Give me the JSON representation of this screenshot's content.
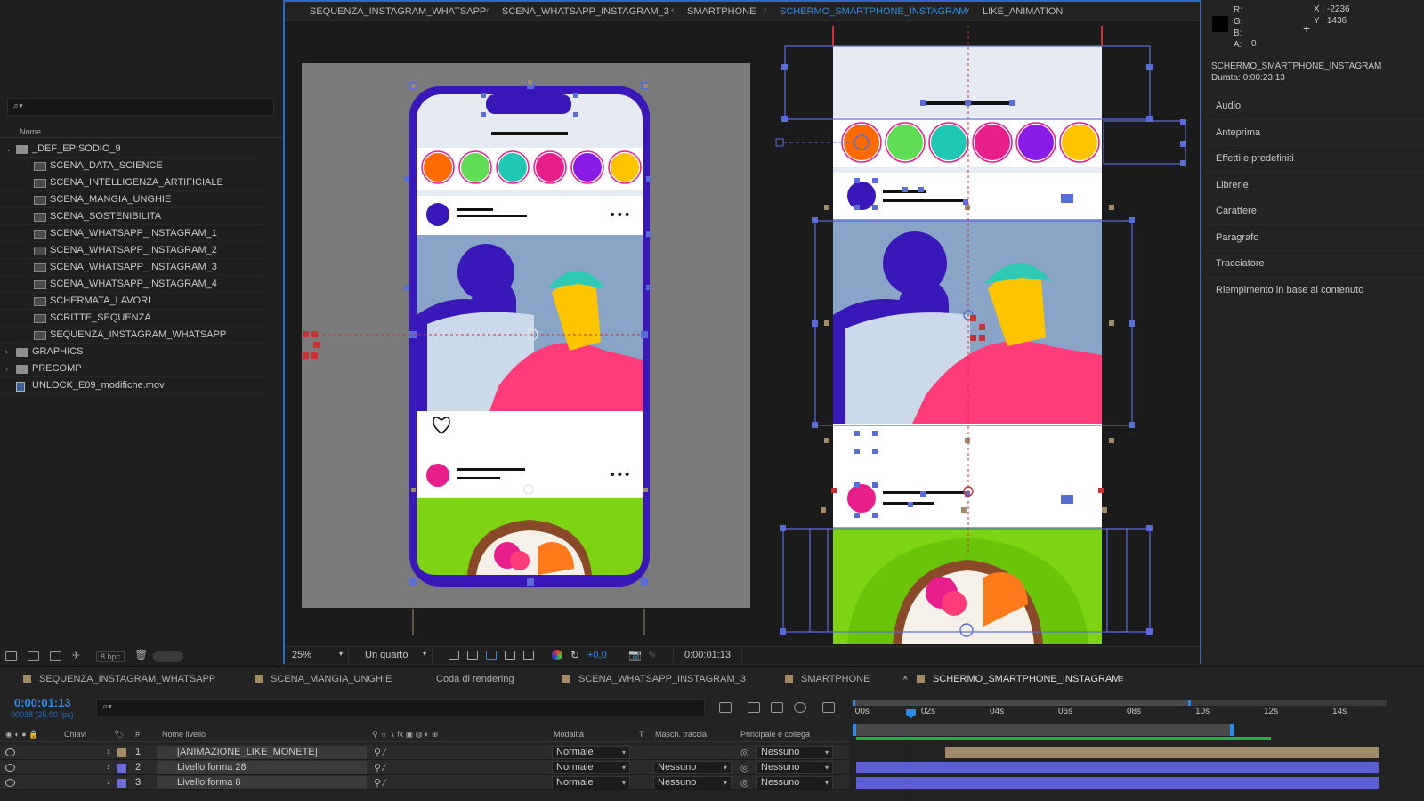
{
  "project": {
    "search_placeholder": "",
    "column_name": "Nome",
    "items": [
      {
        "type": "folder",
        "label": "_DEF_EPISODIO_9",
        "expanded": true,
        "indent": 0
      },
      {
        "type": "comp",
        "label": "SCENA_DATA_SCIENCE",
        "indent": 1
      },
      {
        "type": "comp",
        "label": "SCENA_INTELLIGENZA_ARTIFICIALE",
        "indent": 1
      },
      {
        "type": "comp",
        "label": "SCENA_MANGIA_UNGHIE",
        "indent": 1
      },
      {
        "type": "comp",
        "label": "SCENA_SOSTENIBILITA",
        "indent": 1
      },
      {
        "type": "comp",
        "label": "SCENA_WHATSAPP_INSTAGRAM_1",
        "indent": 1
      },
      {
        "type": "comp",
        "label": "SCENA_WHATSAPP_INSTAGRAM_2",
        "indent": 1
      },
      {
        "type": "comp",
        "label": "SCENA_WHATSAPP_INSTAGRAM_3",
        "indent": 1
      },
      {
        "type": "comp",
        "label": "SCENA_WHATSAPP_INSTAGRAM_4",
        "indent": 1
      },
      {
        "type": "comp",
        "label": "SCHERMATA_LAVORI",
        "indent": 1
      },
      {
        "type": "comp",
        "label": "SCRITTE_SEQUENZA",
        "indent": 1
      },
      {
        "type": "comp",
        "label": "SEQUENZA_INSTAGRAM_WHATSAPP",
        "indent": 1
      },
      {
        "type": "folder",
        "label": "GRAPHICS",
        "expanded": false,
        "indent": 0
      },
      {
        "type": "folder",
        "label": "PRECOMP",
        "expanded": false,
        "indent": 0
      },
      {
        "type": "file",
        "label": "UNLOCK_E09_modifiche.mov",
        "indent": 0
      }
    ],
    "bpc": "8 bpc"
  },
  "viewer": {
    "breadcrumbs": [
      "SEQUENZA_INSTAGRAM_WHATSAPP",
      "SCENA_WHATSAPP_INSTAGRAM_3",
      "SMARTPHONE",
      "SCHERMO_SMARTPHONE_INSTAGRAM",
      "LIKE_ANIMATION"
    ],
    "active_crumb": 3,
    "zoom": "25%",
    "resolution": "Un quarto",
    "exposure": "+0,0",
    "timecode": "0:00:01:13",
    "story_colors": [
      "#ff6a00",
      "#5fde55",
      "#1ec8b4",
      "#e81e8c",
      "#8a1ae8",
      "#ffc400"
    ]
  },
  "info": {
    "r_label": "R:",
    "g_label": "G:",
    "b_label": "B:",
    "a_label": "A:",
    "a_value": "0",
    "x": "X : -2236",
    "y": "Y : 1436",
    "comp_name": "SCHERMO_SMARTPHONE_INSTAGRAM",
    "duration": "Durata: 0:00:23:13"
  },
  "panels": [
    "Audio",
    "Anteprima",
    "Effetti e predefiniti",
    "Librerie",
    "Carattere",
    "Paragrafo",
    "Tracciatore",
    "Riempimento in base al contenuto"
  ],
  "timeline": {
    "tabs": [
      {
        "label": "SEQUENZA_INSTAGRAM_WHATSAPP",
        "square": true
      },
      {
        "label": "SCENA_MANGIA_UNGHIE",
        "square": true
      },
      {
        "label": "Coda di rendering",
        "square": false
      },
      {
        "label": "SCENA_WHATSAPP_INSTAGRAM_3",
        "square": true
      },
      {
        "label": "SMARTPHONE",
        "square": true
      },
      {
        "label": "SCHERMO_SMARTPHONE_INSTAGRAM",
        "square": true,
        "active": true
      }
    ],
    "close": "×",
    "menu": "≡",
    "current_time": "0:00:01:13",
    "fps": "00038 (25.00 fps)",
    "ruler_ticks": [
      ":00s",
      "02s",
      "04s",
      "06s",
      "08s",
      "10s",
      "12s",
      "14s"
    ],
    "columns": {
      "keys": "Chiavi",
      "num": "#",
      "name": "Nome livello",
      "mode": "Modalità",
      "t": "T",
      "matte": "Masch. traccia",
      "parent": "Principale e collega"
    },
    "layers": [
      {
        "num": "1",
        "name": "[ANIMAZIONE_LIKE_MONETE]",
        "label_color": "#a68a62",
        "mode": "Normale",
        "matte": "",
        "parent": "Nessuno",
        "bar_color": "#a08a68",
        "bar_start_frac": 0.17
      },
      {
        "num": "2",
        "name": "Livello forma 28",
        "label_color": "#6c6cd8",
        "mode": "Normale",
        "matte": "Nessuno",
        "parent": "Nessuno",
        "bar_color": "#5d5fd0",
        "bar_start_frac": 0
      },
      {
        "num": "3",
        "name": "Livello forma 8",
        "label_color": "#6c6cd8",
        "mode": "Normale",
        "matte": "Nessuno",
        "parent": "Nessuno",
        "bar_color": "#5d5fd0",
        "bar_start_frac": 0
      }
    ]
  }
}
